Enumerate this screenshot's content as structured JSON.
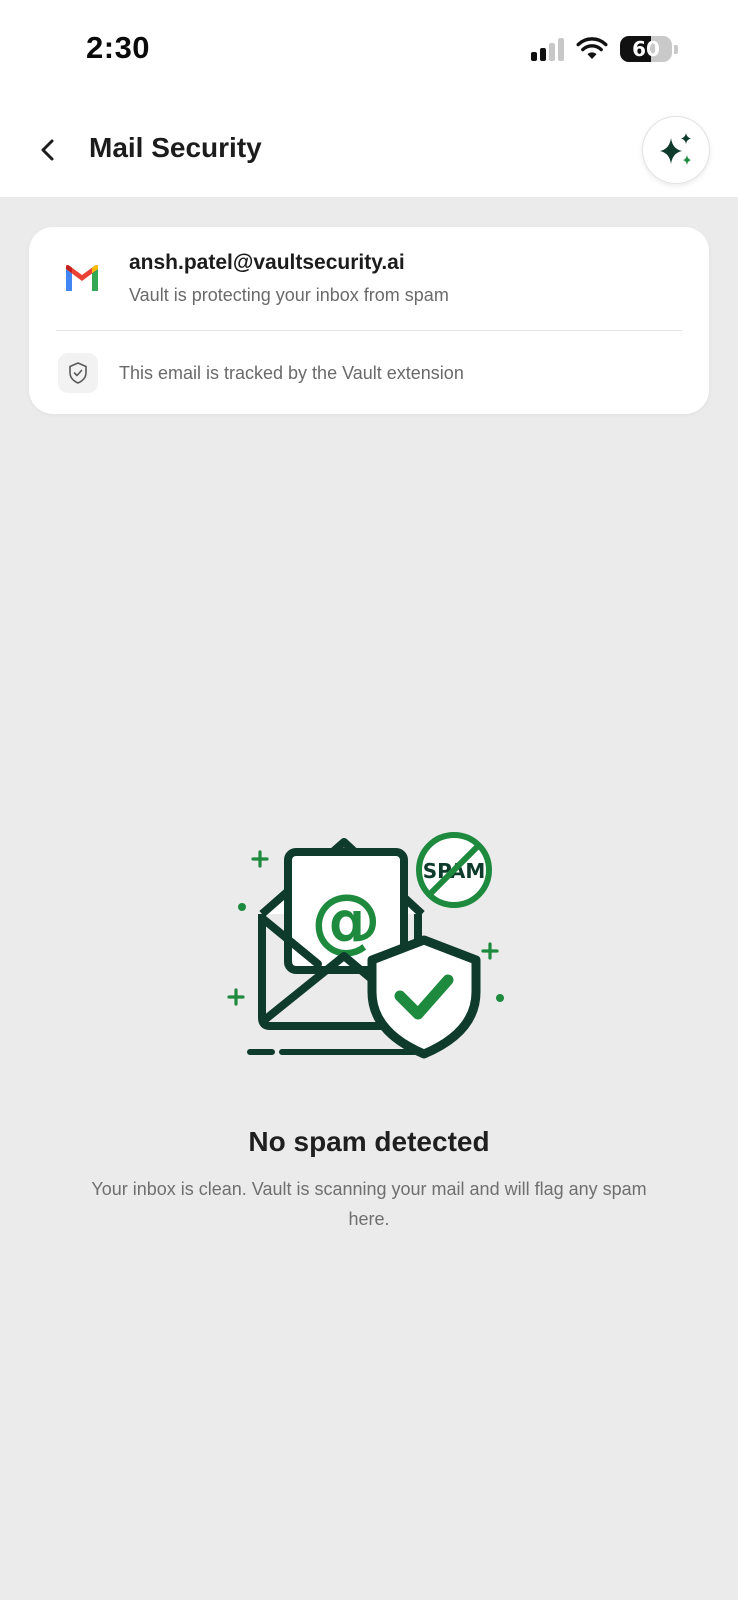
{
  "status_bar": {
    "time": "2:30",
    "battery": "60",
    "battery_level": 0.6
  },
  "header": {
    "title": "Mail Security",
    "back_icon": "chevron-left-icon",
    "ai_icon": "sparkle-icon"
  },
  "account": {
    "provider_icon": "gmail-icon",
    "email": "ansh.patel@vaultsecurity.ai",
    "subtitle": "Vault is protecting your inbox from spam",
    "tracked_text": "This email is tracked by the Vault extension",
    "tracked_icon": "shield-check-icon"
  },
  "empty_state": {
    "illustration_badge": "SPAM",
    "title": "No spam detected",
    "description": "Your inbox is clean. Vault is scanning your mail and will flag any spam here."
  },
  "colors": {
    "accent_green": "#1e8a3e",
    "dark_green": "#0e3b2b",
    "background": "#ebebeb"
  }
}
